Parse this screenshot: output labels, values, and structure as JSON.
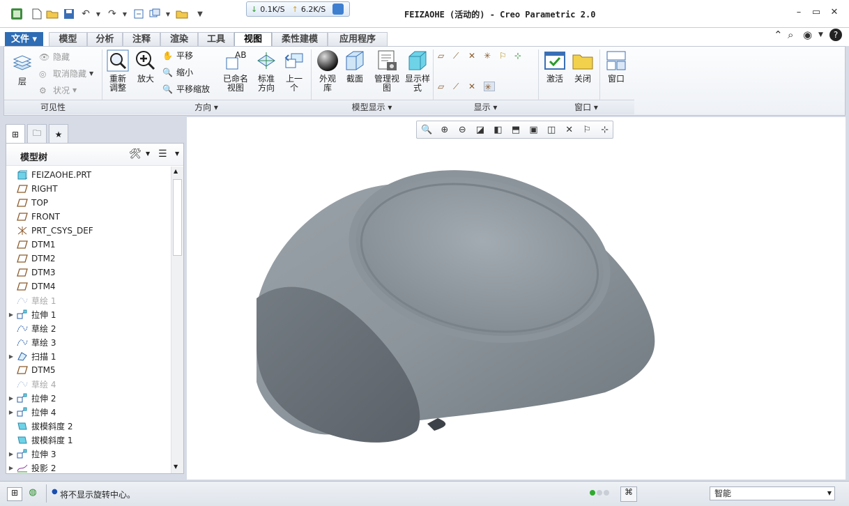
{
  "window": {
    "title": "FEIZAOHE (活动的) - Creo Parametric 2.0",
    "network": {
      "down": "0.1K/S",
      "up": "6.2K/S"
    }
  },
  "ribbon_tabs": [
    "文件",
    "模型",
    "分析",
    "注释",
    "渲染",
    "工具",
    "视图",
    "柔性建模",
    "应用程序"
  ],
  "active_tab": "视图",
  "visibility": {
    "layers": "层",
    "hide": "隐藏",
    "unhide": "取消隐藏",
    "status": "状况",
    "group_label": "可见性"
  },
  "orientation": {
    "refit": "重新\n调整",
    "zoom_in": "放大",
    "pan": "平移",
    "zoom_out": "缩小",
    "pan_zoom": "平移缩放",
    "named_views": "已命名\n视图",
    "standard": "标准\n方向",
    "previous": "上一\n个",
    "group_label": "方向"
  },
  "model_display": {
    "appearance": "外观\n库",
    "section": "截面",
    "manage_views": "管理视\n图",
    "display_style": "显示样\n式",
    "group_label": "模型显示"
  },
  "show": {
    "group_label": "显示"
  },
  "window_group": {
    "activate": "激活",
    "close": "关闭",
    "windows": "窗口",
    "group_label": "窗口"
  },
  "model_tree": {
    "title": "模型树",
    "items": [
      {
        "label": "FEIZAOHE.PRT",
        "icon": "part-icon",
        "expand": false,
        "disabled": false
      },
      {
        "label": "RIGHT",
        "icon": "datum-plane-icon",
        "expand": false,
        "disabled": false
      },
      {
        "label": "TOP",
        "icon": "datum-plane-icon",
        "expand": false,
        "disabled": false
      },
      {
        "label": "FRONT",
        "icon": "datum-plane-icon",
        "expand": false,
        "disabled": false
      },
      {
        "label": "PRT_CSYS_DEF",
        "icon": "csys-icon",
        "expand": false,
        "disabled": false
      },
      {
        "label": "DTM1",
        "icon": "datum-plane-icon",
        "expand": false,
        "disabled": false
      },
      {
        "label": "DTM2",
        "icon": "datum-plane-icon",
        "expand": false,
        "disabled": false
      },
      {
        "label": "DTM3",
        "icon": "datum-plane-icon",
        "expand": false,
        "disabled": false
      },
      {
        "label": "DTM4",
        "icon": "datum-plane-icon",
        "expand": false,
        "disabled": false
      },
      {
        "label": "草绘 1",
        "icon": "sketch-icon",
        "expand": false,
        "disabled": true
      },
      {
        "label": "拉伸 1",
        "icon": "extrude-icon",
        "expand": true,
        "disabled": false
      },
      {
        "label": "草绘 2",
        "icon": "sketch-icon",
        "expand": false,
        "disabled": false
      },
      {
        "label": "草绘 3",
        "icon": "sketch-icon",
        "expand": false,
        "disabled": false
      },
      {
        "label": "扫描 1",
        "icon": "sweep-icon",
        "expand": true,
        "disabled": false
      },
      {
        "label": "DTM5",
        "icon": "datum-plane-icon",
        "expand": false,
        "disabled": false
      },
      {
        "label": "草绘 4",
        "icon": "sketch-icon",
        "expand": false,
        "disabled": true
      },
      {
        "label": "拉伸 2",
        "icon": "extrude-icon",
        "expand": true,
        "disabled": false
      },
      {
        "label": "拉伸 4",
        "icon": "extrude-icon",
        "expand": true,
        "disabled": false
      },
      {
        "label": "拔模斜度 2",
        "icon": "draft-icon",
        "expand": false,
        "disabled": false
      },
      {
        "label": "拔模斜度 1",
        "icon": "draft-icon",
        "expand": false,
        "disabled": false
      },
      {
        "label": "拉伸 3",
        "icon": "extrude-icon",
        "expand": true,
        "disabled": false
      },
      {
        "label": "投影 2",
        "icon": "projection-icon",
        "expand": true,
        "disabled": false
      }
    ]
  },
  "status": {
    "message": "将不显示旋转中心。",
    "filter_value": "智能"
  },
  "colors": {
    "accent": "#2e6db4",
    "model": "#7f8891",
    "ribbon_bg": "#eef1f6"
  }
}
